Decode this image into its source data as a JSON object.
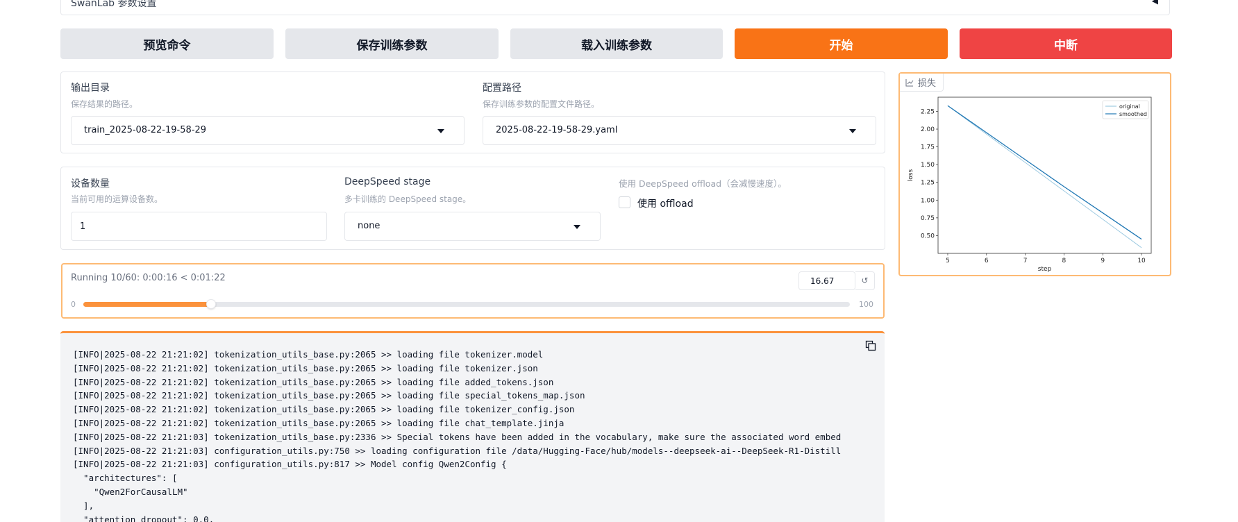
{
  "accordion": {
    "label": "SwanLab 参数设置"
  },
  "buttons": {
    "preview": "预览命令",
    "save": "保存训练参数",
    "load": "载入训练参数",
    "start": "开始",
    "abort": "中断"
  },
  "output_dir": {
    "label": "输出目录",
    "info": "保存结果的路径。",
    "value": "train_2025-08-22-19-58-29"
  },
  "config_path": {
    "label": "配置路径",
    "info": "保存训练参数的配置文件路径。",
    "value": "2025-08-22-19-58-29.yaml"
  },
  "device_count": {
    "label": "设备数量",
    "info": "当前可用的运算设备数。",
    "value": "1"
  },
  "ds_stage": {
    "label": "DeepSpeed stage",
    "info": "多卡训练的 DeepSpeed stage。",
    "value": "none"
  },
  "ds_offload": {
    "info": "使用 DeepSpeed offload（会减慢速度）。",
    "label": "使用 offload"
  },
  "progress": {
    "label": "Running 10/60: 0:00:16 < 0:01:22",
    "value": "16.67",
    "percent": 16.67,
    "min": "0",
    "max": "100",
    "reset_icon": "↺"
  },
  "log": {
    "lines": [
      "[INFO|2025-08-22 21:21:02] tokenization_utils_base.py:2065 >> loading file tokenizer.model",
      "[INFO|2025-08-22 21:21:02] tokenization_utils_base.py:2065 >> loading file tokenizer.json",
      "[INFO|2025-08-22 21:21:02] tokenization_utils_base.py:2065 >> loading file added_tokens.json",
      "[INFO|2025-08-22 21:21:02] tokenization_utils_base.py:2065 >> loading file special_tokens_map.json",
      "[INFO|2025-08-22 21:21:02] tokenization_utils_base.py:2065 >> loading file tokenizer_config.json",
      "[INFO|2025-08-22 21:21:02] tokenization_utils_base.py:2065 >> loading file chat_template.jinja",
      "[INFO|2025-08-22 21:21:03] tokenization_utils_base.py:2336 >> Special tokens have been added in the vocabulary, make sure the associated word embed",
      "[INFO|2025-08-22 21:21:03] configuration_utils.py:750 >> loading configuration file /data/Hugging-Face/hub/models--deepseek-ai--DeepSeek-R1-Distill",
      "[INFO|2025-08-22 21:21:03] configuration_utils.py:817 >> Model config Qwen2Config {",
      "  \"architectures\": [",
      "    \"Qwen2ForCausalLM\"",
      "  ],",
      "  \"attention_dropout\": 0.0,"
    ]
  },
  "chart_panel": {
    "tag": "损失"
  },
  "chart_data": {
    "type": "line",
    "xlabel": "step",
    "ylabel": "loss",
    "xlim": [
      4.75,
      10.25
    ],
    "ylim": [
      0.25,
      2.45
    ],
    "xticks": [
      "5",
      "6",
      "7",
      "8",
      "9",
      "10"
    ],
    "yticks": [
      "0.50",
      "0.75",
      "1.00",
      "1.25",
      "1.50",
      "1.75",
      "2.00",
      "2.25"
    ],
    "legend_position": "top-right",
    "series": [
      {
        "name": "original",
        "color": "#9ecae1",
        "x": [
          5,
          6,
          7,
          8,
          9,
          10
        ],
        "y": [
          2.33,
          1.93,
          1.53,
          1.13,
          0.73,
          0.33
        ]
      },
      {
        "name": "smoothed",
        "color": "#1f77b4",
        "x": [
          5,
          6,
          7,
          8,
          9,
          10
        ],
        "y": [
          2.33,
          1.95,
          1.57,
          1.19,
          0.82,
          0.45
        ]
      }
    ]
  }
}
